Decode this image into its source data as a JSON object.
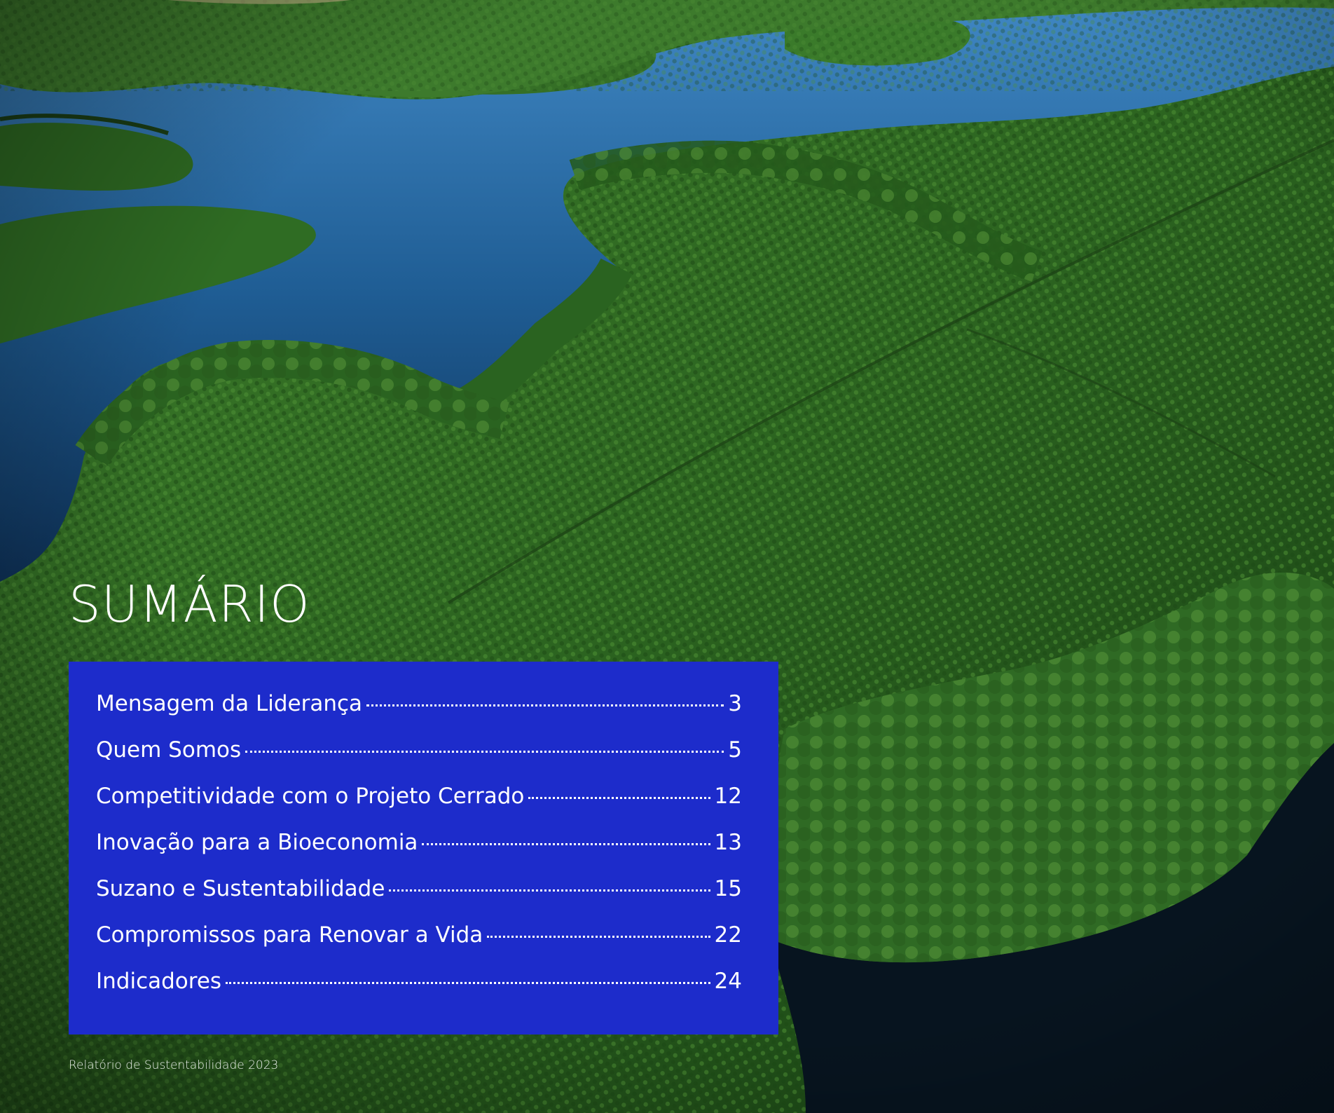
{
  "document": {
    "title": "SUMÁRIO",
    "footer": "Relatório de Sustentabilidade 2023",
    "background_image": "aerial-forest-lake-photo",
    "colors": {
      "panel": "#1d2ccb",
      "water": "#1f5d94",
      "forest": "#2f6b24",
      "text": "#ffffff"
    }
  },
  "toc": {
    "items": [
      {
        "label": "Mensagem da Liderança",
        "page": "3"
      },
      {
        "label": "Quem Somos",
        "page": "5"
      },
      {
        "label": "Competitividade com o Projeto Cerrado",
        "page": "12"
      },
      {
        "label": "Inovação para a Bioeconomia",
        "page": "13"
      },
      {
        "label": "Suzano e Sustentabilidade",
        "page": "15"
      },
      {
        "label": "Compromissos para Renovar a Vida",
        "page": "22"
      },
      {
        "label": "Indicadores",
        "page": "24"
      }
    ]
  }
}
